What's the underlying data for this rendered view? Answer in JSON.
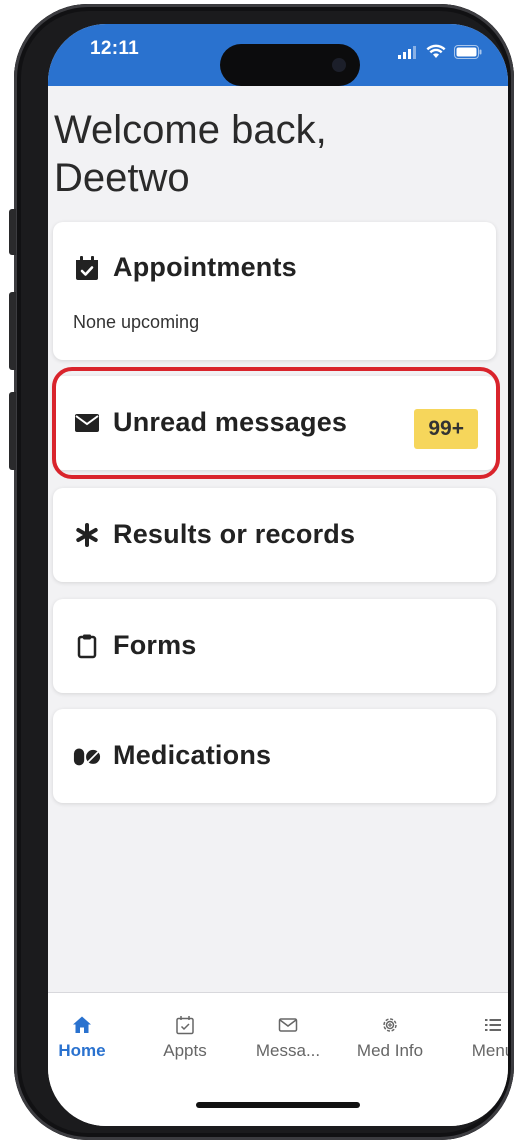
{
  "status_bar": {
    "time": "12:11",
    "background_color": "#2a72cf"
  },
  "header": {
    "welcome_line1": "Welcome back,",
    "welcome_line2": "Deetwo"
  },
  "cards": {
    "appointments": {
      "icon": "calendar-check-icon",
      "title": "Appointments",
      "subtitle": "None upcoming"
    },
    "messages": {
      "icon": "envelope-icon",
      "title": "Unread messages",
      "badge": "99+",
      "badge_color": "#f6d65b",
      "highlight_color": "#d9242c"
    },
    "results": {
      "icon": "asterisk-icon",
      "title": "Results or records"
    },
    "forms": {
      "icon": "clipboard-icon",
      "title": "Forms"
    },
    "medications": {
      "icon": "pills-icon",
      "title": "Medications"
    }
  },
  "tabbar": {
    "active_color": "#2a72cf",
    "tabs": [
      {
        "label": "Home",
        "icon": "home-icon",
        "active": true
      },
      {
        "label": "Appts",
        "icon": "calendar-check-icon",
        "active": false
      },
      {
        "label": "Messa...",
        "icon": "envelope-icon",
        "active": false
      },
      {
        "label": "Med Info",
        "icon": "medical-cog-icon",
        "active": false
      },
      {
        "label": "Menu",
        "icon": "list-icon",
        "active": false
      }
    ]
  }
}
